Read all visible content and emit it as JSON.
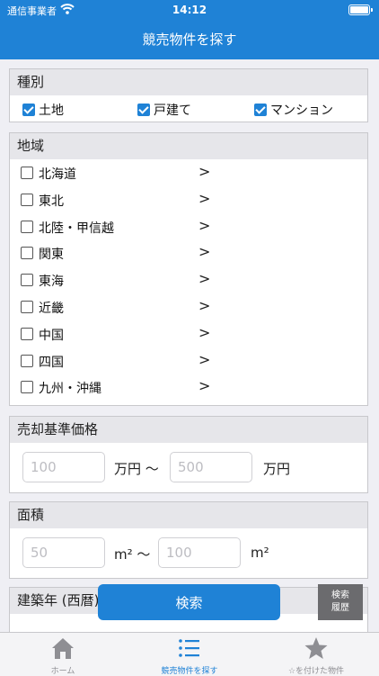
{
  "status_bar": {
    "carrier": "通信事業者",
    "time": "14:12"
  },
  "nav": {
    "title": "競売物件を探す"
  },
  "type_section": {
    "header": "種別",
    "options": [
      {
        "label": "土地",
        "checked": true
      },
      {
        "label": "戸建て",
        "checked": true
      },
      {
        "label": "マンション",
        "checked": true
      }
    ]
  },
  "region_section": {
    "header": "地域",
    "items": [
      {
        "label": "北海道"
      },
      {
        "label": "東北"
      },
      {
        "label": "北陸・甲信越"
      },
      {
        "label": "関東"
      },
      {
        "label": "東海"
      },
      {
        "label": "近畿"
      },
      {
        "label": "中国"
      },
      {
        "label": "四国"
      },
      {
        "label": "九州・沖縄"
      }
    ],
    "chevron": ">"
  },
  "price_section": {
    "header": "売却基準価格",
    "min_placeholder": "100",
    "min_unit": "万円 〜",
    "max_placeholder": "500",
    "max_unit": "万円"
  },
  "area_section": {
    "header": "面積",
    "min_placeholder": "50",
    "min_unit": "m² 〜",
    "max_placeholder": "100",
    "max_unit": "m²"
  },
  "year_section": {
    "header": "建築年 (西暦)"
  },
  "actions": {
    "search_label": "検索",
    "history_label_1": "検索",
    "history_label_2": "履歴"
  },
  "tabs": [
    {
      "label": "ホーム",
      "icon": "home-icon"
    },
    {
      "label": "競売物件を探す",
      "icon": "list-icon",
      "active": true
    },
    {
      "label": "☆を付けた物件",
      "icon": "star-icon"
    }
  ],
  "colors": {
    "accent": "#1f82d6",
    "history_bg": "#6b6b6e"
  }
}
